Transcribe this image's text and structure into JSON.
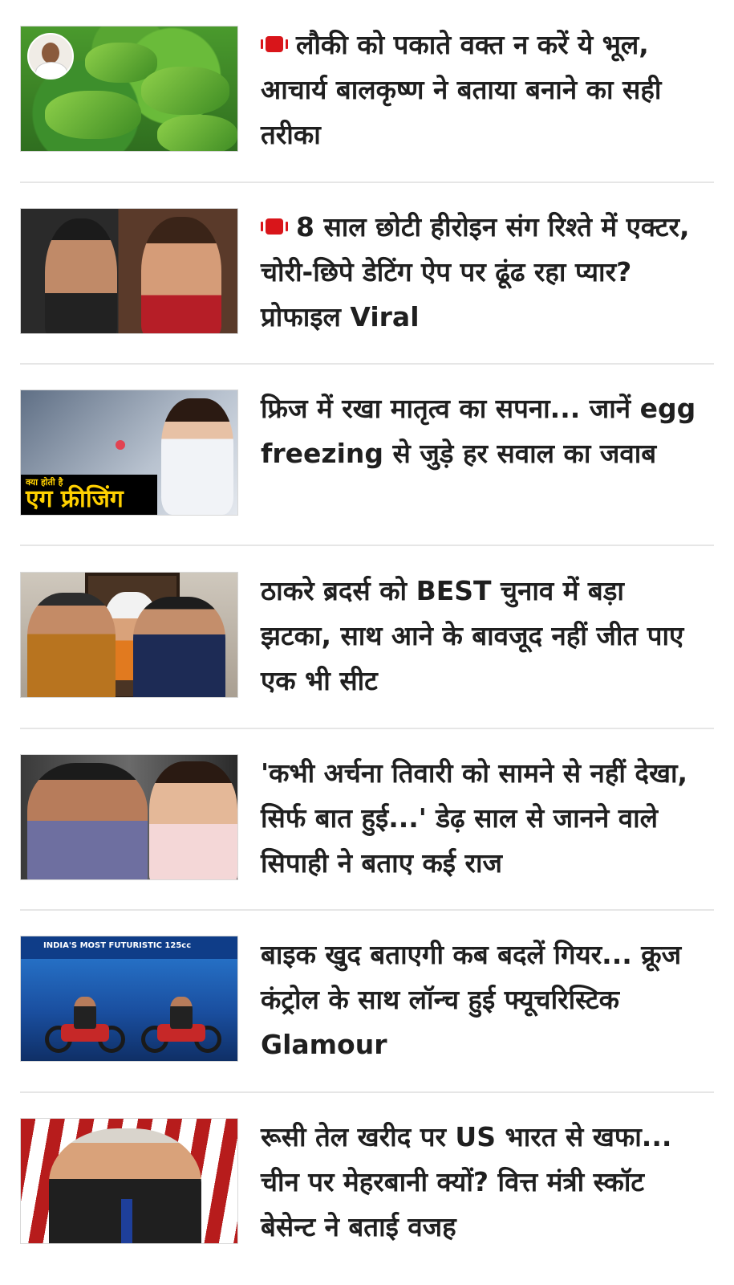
{
  "articles": [
    {
      "has_video": true,
      "headline": "लौकी को पकाते वक्त न करें ये भूल, आचार्य बालकृष्ण ने बताया बनाने का सही तरीका"
    },
    {
      "has_video": true,
      "headline": "8 साल छोटी हीरोइन संग रिश्ते में एक्टर, चोरी-छिपे डेटिंग ऐप पर ढूंढ रहा प्यार? प्रोफाइल Viral"
    },
    {
      "has_video": false,
      "headline": "फ्रिज में रखा मातृत्व का सपना... जानें egg freezing से जुड़े हर सवाल का जवाब",
      "thumb_label_small": "क्या होती है",
      "thumb_label_big": "एग फ्रीजिंग"
    },
    {
      "has_video": false,
      "headline": "ठाकरे ब्रदर्स को BEST चुनाव में बड़ा झटका, साथ आने के बावजूद नहीं जीत पाए एक भी सीट"
    },
    {
      "has_video": false,
      "headline": "'कभी अर्चना तिवारी को सामने से नहीं देखा, सिर्फ बात हुई...' डेढ़ साल से जानने वाले सिपाही ने बताए कई राज"
    },
    {
      "has_video": false,
      "headline": "बाइक खुद बताएगी कब बदलें गियर... क्रूज कंट्रोल के साथ लॉन्च हुई फ्यूचरिस्टिक Glamour",
      "thumb_banner": "INDIA'S MOST FUTURISTIC 125cc"
    },
    {
      "has_video": false,
      "headline": "रूसी तेल खरीद पर US भारत से खफा... चीन पर मेहरबानी क्यों? वित्त मंत्री स्कॉट बेसेन्ट ने बताई वजह"
    }
  ],
  "colors": {
    "video_icon": "#d9151a",
    "headline_text": "#1f1f1f",
    "divider": "#e6e6e6"
  },
  "icons": {
    "video": "video-camera-icon"
  }
}
